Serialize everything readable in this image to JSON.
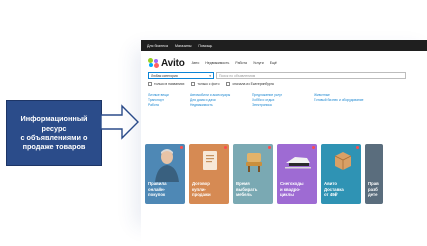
{
  "callout": {
    "lines": [
      "Информационный",
      "ресурс",
      "с объявлениями о",
      "продаже товаров"
    ]
  },
  "topbar": {
    "items": [
      "Для бизнеса",
      "Магазины",
      "Помощь"
    ]
  },
  "logo": {
    "text": "Avito"
  },
  "nav": {
    "items": [
      "Авто",
      "Недвижимость",
      "Работа",
      "Услуги",
      "Ещё"
    ]
  },
  "search": {
    "category": "Любая категория",
    "placeholder": "Поиск по объявлениям"
  },
  "filters": [
    "только в названиях",
    "только с фото",
    "сначала из Екатеринбурга"
  ],
  "links": {
    "rows": [
      [
        "Личные вещи",
        "Автомобили и аксессуары",
        "Предложение услуг",
        "Животные"
      ],
      [
        "Транспорт",
        "Для дома и дачи",
        "Хобби и отдых",
        "Готовый бизнес и оборудование"
      ],
      [
        "Работа",
        "Недвижимость",
        "Электроника",
        ""
      ]
    ]
  },
  "cards": [
    {
      "label": "Правила\nонлайн-\nпокупок",
      "color": "#4e88b5"
    },
    {
      "label": "Договор\nкупли-\nпродажи",
      "color": "#d68a53"
    },
    {
      "label": "Время\nвыбирать\nмебель",
      "color": "#7aa9b3"
    },
    {
      "label": "Снегоходы\nи квадро-\nциклы",
      "color": "#9e6bd3"
    },
    {
      "label": "Авито\nДоставка\nот 49₽",
      "color": "#2f93b4"
    },
    {
      "label": "Прав\nразб\nдете",
      "color": "#5a6d7d"
    }
  ],
  "colors": {
    "callout_bg": "#2b4c8a",
    "topbar_bg": "#1f1f1f",
    "link": "#1a86d0",
    "arrow_stroke": "#2b4c8a"
  }
}
